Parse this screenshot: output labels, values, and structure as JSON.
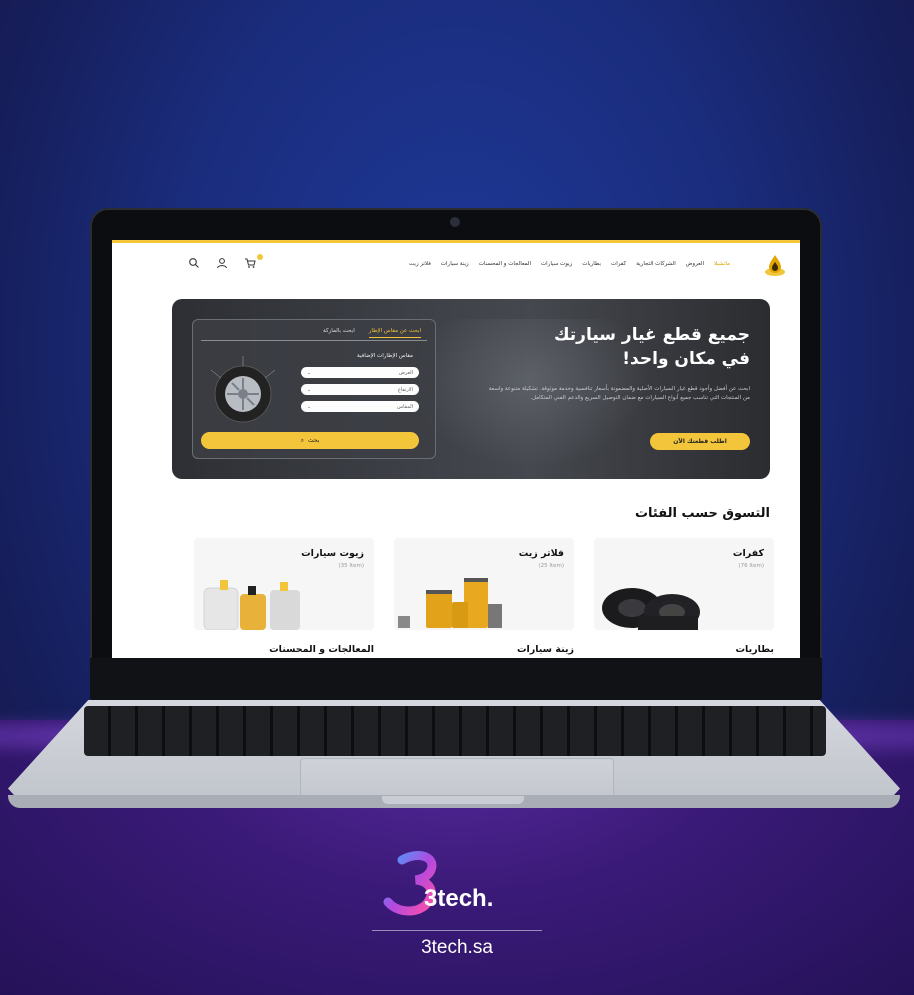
{
  "nav": {
    "items": [
      "ماتشيلا",
      "العروض",
      "الشركات التجارية",
      "كفرات",
      "بطاريات",
      "زيوت سيارات",
      "المعالجات و المحسنات",
      "زينة سيارات",
      "فلاتر زيت"
    ]
  },
  "hero": {
    "title_line1": "جميع قطع غيار سيارتك",
    "title_line2": "في مكان واحد!",
    "description": "ابحث عن أفضل وأجود قطع غيار السيارات الأصلية والمضمونة بأسعار تنافسية وخدمة موثوقة. تشكيلة متنوعة واسعة من المنتجات التي تناسب جميع أنواع السيارات مع ضمان التوصيل السريع والدعم الفني المتكامل.",
    "cta_label": "اطلب قطعتك الآن"
  },
  "search_panel": {
    "tab_size": "ابحث عن مقاس الإطار",
    "tab_brand": "ابحث بالماركة",
    "size_label": "مقاس الإطارات الإضافية",
    "field1": "العرض",
    "field2": "الارتفاع",
    "field3": "المقاس",
    "search_label": "بحث"
  },
  "categories": {
    "title": "التسوق حسب الفئات",
    "items": [
      {
        "name": "كفرات",
        "count": "(76 Item)"
      },
      {
        "name": "فلاتر زيت",
        "count": "(25 Item)"
      },
      {
        "name": "زيوت سيارات",
        "count": "(35 Item)"
      }
    ],
    "row2": [
      "بطاريات",
      "زينة سيارات",
      "المعالجات و المحسنات"
    ]
  },
  "brand": {
    "logo_text": "3tech.",
    "url": "3tech.sa"
  },
  "colors": {
    "accent": "#f3c53a",
    "background": "#1a2c7c",
    "ground": "#3a1a78"
  }
}
